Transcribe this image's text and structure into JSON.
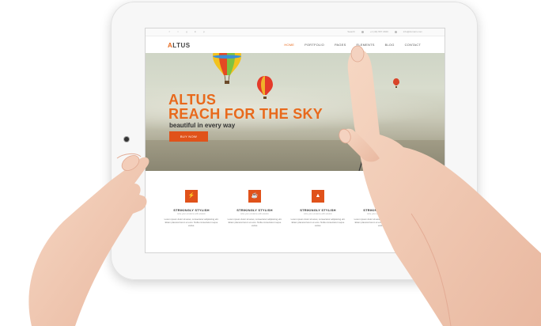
{
  "topbar": {
    "social": [
      "f",
      "t",
      "g",
      "in",
      "p"
    ],
    "phone": "+1 (44) 567 2940",
    "email": "info@domain.com",
    "search": "Search"
  },
  "nav": {
    "logo_accent": "A",
    "logo_rest": "LTUS",
    "items": [
      "HOME",
      "PORTFOLIO",
      "PAGES",
      "ELEMENTS",
      "BLOG",
      "CONTACT"
    ],
    "active": "HOME"
  },
  "hero": {
    "title_line1": "ALTUS",
    "title_line2": "REACH FOR THE SKY",
    "subtitle": "beautiful in every way",
    "button": "BUY NOW"
  },
  "features": [
    {
      "icon": "lightning-icon",
      "title": "STRIKINGLY STYLISH",
      "sub": "write your emotions with wisdom",
      "desc": "Lorem ipsum dolor sit amet, consectetur adipisicing elit. Etiam placerat lorem et eros. Nulla consectetur neque varius."
    },
    {
      "icon": "coffee-icon",
      "title": "STRIKINGLY STYLISH",
      "sub": "write your emotions with wisdom",
      "desc": "Lorem ipsum dolor sit amet, consectetur adipisicing elit. Etiam placerat lorem et eros. Nulla consectetur neque varius."
    },
    {
      "icon": "cone-icon",
      "title": "STRIKINGLY STYLISH",
      "sub": "write your emotions with wisdom",
      "desc": "Lorem ipsum dolor sit amet, consectetur adipisicing elit. Etiam placerat lorem et eros. Nulla consectetur neque varius."
    },
    {
      "icon": "star-icon",
      "title": "STRIKINGLY STYLISH",
      "sub": "write your emotions with wisdom",
      "desc": "Lorem ipsum dolor sit amet, consectetur adipisicing elit. Etiam placerat lorem et eros. Nulla consectetur neque varius."
    }
  ],
  "colors": {
    "accent": "#e8691c",
    "button": "#e0521a"
  }
}
